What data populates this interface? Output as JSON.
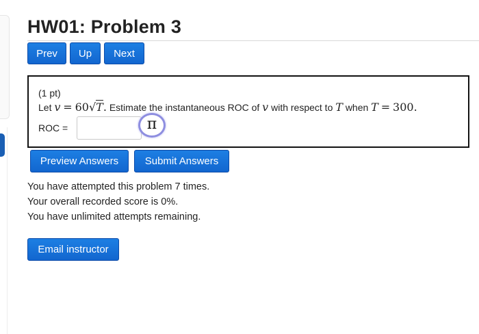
{
  "page": {
    "title": "HW01: Problem 3"
  },
  "nav": {
    "prev_label": "Prev",
    "up_label": "Up",
    "next_label": "Next"
  },
  "problem": {
    "points": "(1 pt)",
    "let_word": "Let",
    "var_v": "v",
    "equals": "=",
    "coef": "60",
    "sqrt_symbol": "√",
    "var_T": "T",
    "period": ".",
    "estimate_text": "Estimate the instantaneous ROC of",
    "respect_text": "with respect to",
    "when_word": "when",
    "value_300": "300.",
    "roc_label": "ROC =",
    "answer_value": "",
    "pi_symbol": "π"
  },
  "actions": {
    "preview_label": "Preview Answers",
    "submit_label": "Submit Answers"
  },
  "status": {
    "attempts": "You have attempted this problem 7 times.",
    "score": "Your overall recorded score is 0%.",
    "remaining": "You have unlimited attempts remaining."
  },
  "footer": {
    "email_label": "Email instructor"
  },
  "colors": {
    "button_blue": "#1266cf",
    "button_border": "#0b4aa8",
    "pi_ring": "#8e8ee0",
    "box_border": "#111111"
  },
  "icons": {
    "pi": "pi-icon"
  }
}
